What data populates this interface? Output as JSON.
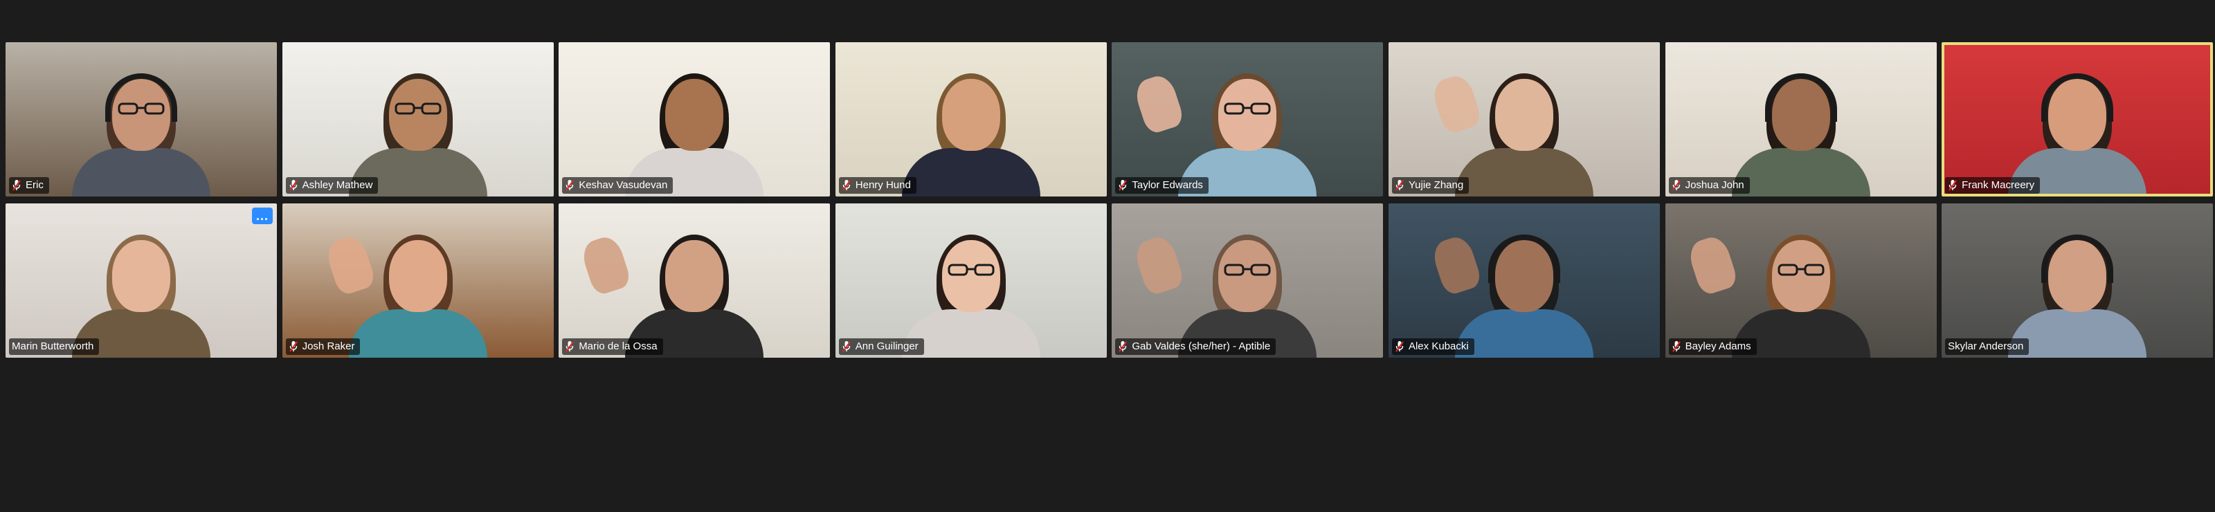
{
  "meeting": {
    "view": "gallery",
    "participants": [
      {
        "name": "Eric",
        "muted": true,
        "active_speaker": false,
        "scene": {
          "bg": "#6d5b4a",
          "wall": "#b9b2a6",
          "skin": "#c99578",
          "hair": "#4a3326",
          "shirt": "#4f5560",
          "headphones": true,
          "glasses": true,
          "wave": false
        }
      },
      {
        "name": "Ashley Mathew",
        "muted": true,
        "active_speaker": false,
        "scene": {
          "bg": "#d8d6cf",
          "wall": "#f2f1ec",
          "skin": "#b98560",
          "hair": "#3b2a1e",
          "shirt": "#6b6a5c",
          "headphones": false,
          "glasses": true,
          "wave": false
        }
      },
      {
        "name": "Keshav Vasudevan",
        "muted": true,
        "active_speaker": false,
        "scene": {
          "bg": "#e5e0d6",
          "wall": "#f4f0e7",
          "skin": "#a8734f",
          "hair": "#1d1714",
          "shirt": "#d9d4d2",
          "headphones": false,
          "glasses": false,
          "wave": false
        }
      },
      {
        "name": "Henry Hund",
        "muted": true,
        "active_speaker": false,
        "scene": {
          "bg": "#d9d2c0",
          "wall": "#ece6d6",
          "skin": "#d6a07c",
          "hair": "#7b5a33",
          "shirt": "#262a3b",
          "headphones": false,
          "glasses": false,
          "wave": false
        }
      },
      {
        "name": "Taylor Edwards",
        "muted": true,
        "active_speaker": false,
        "scene": {
          "bg": "#3f4a4a",
          "wall": "#566261",
          "skin": "#e4b59c",
          "hair": "#6a4a30",
          "shirt": "#8fb6cb",
          "headphones": false,
          "glasses": true,
          "wave": true
        }
      },
      {
        "name": "Yujie Zhang",
        "muted": true,
        "active_speaker": false,
        "scene": {
          "bg": "#bfb7ad",
          "wall": "#dcd6cd",
          "skin": "#e0b69a",
          "hair": "#2c1f18",
          "shirt": "#6b5a44",
          "headphones": false,
          "glasses": false,
          "wave": true
        }
      },
      {
        "name": "Joshua John",
        "muted": true,
        "active_speaker": false,
        "scene": {
          "bg": "#d7cfc2",
          "wall": "#ece7de",
          "skin": "#9f6d4f",
          "hair": "#231a15",
          "shirt": "#5a6856",
          "headphones": true,
          "glasses": false,
          "wave": false
        }
      },
      {
        "name": "Frank Macreery",
        "muted": true,
        "active_speaker": true,
        "scene": {
          "bg": "#b5262b",
          "wall": "#d6393b",
          "skin": "#d79c7c",
          "hair": "#2a1f19",
          "shirt": "#7b8c98",
          "headphones": true,
          "glasses": false,
          "wave": false
        }
      },
      {
        "name": "Marin Butterworth",
        "muted": false,
        "active_speaker": false,
        "scene": {
          "bg": "#cfc8c2",
          "wall": "#e8e3de",
          "skin": "#e5b69a",
          "hair": "#8b6a4a",
          "shirt": "#6e5a40",
          "headphones": false,
          "glasses": false,
          "wave": false
        },
        "menu": "..."
      },
      {
        "name": "Josh Raker",
        "muted": true,
        "active_speaker": false,
        "scene": {
          "bg": "#8a5a34",
          "wall": "#d9cdbd",
          "skin": "#e0a98a",
          "hair": "#5c3a24",
          "shirt": "#3f8e9a",
          "headphones": false,
          "glasses": false,
          "wave": true
        }
      },
      {
        "name": "Mario de la Ossa",
        "muted": true,
        "active_speaker": false,
        "scene": {
          "bg": "#d8d3c9",
          "wall": "#efece5",
          "skin": "#d2a184",
          "hair": "#1f1a17",
          "shirt": "#2b2b2b",
          "headphones": false,
          "glasses": false,
          "wave": true
        }
      },
      {
        "name": "Ann Guilinger",
        "muted": true,
        "active_speaker": false,
        "scene": {
          "bg": "#c8c9c3",
          "wall": "#e2e3dd",
          "skin": "#eac1a7",
          "hair": "#2a1d18",
          "shirt": "#d6d1cc",
          "headphones": false,
          "glasses": true,
          "wave": false
        }
      },
      {
        "name": "Gab Valdes (she/her) - Aptible",
        "muted": true,
        "active_speaker": false,
        "scene": {
          "bg": "#8b8580",
          "wall": "#a8a29d",
          "skin": "#c99a80",
          "hair": "#6f5645",
          "shirt": "#3b3b3b",
          "headphones": false,
          "glasses": true,
          "wave": true
        }
      },
      {
        "name": "Alex Kubacki",
        "muted": true,
        "active_speaker": false,
        "scene": {
          "bg": "#2c3a45",
          "wall": "#415463",
          "skin": "#9f7258",
          "hair": "#1c1c1c",
          "shirt": "#3a6e9a",
          "headphones": true,
          "glasses": false,
          "wave": true
        }
      },
      {
        "name": "Bayley Adams",
        "muted": true,
        "active_speaker": false,
        "scene": {
          "bg": "#4e4a45",
          "wall": "#7a746c",
          "skin": "#d1a084",
          "hair": "#7b4e2b",
          "shirt": "#2a2a2a",
          "headphones": false,
          "glasses": true,
          "wave": true
        }
      },
      {
        "name": "Skylar Anderson",
        "muted": false,
        "active_speaker": false,
        "scene": {
          "bg": "#4a4a48",
          "wall": "#6b6a66",
          "skin": "#d19f84",
          "hair": "#2a211b",
          "shirt": "#8a9bb0",
          "headphones": true,
          "glasses": false,
          "wave": false
        }
      }
    ]
  }
}
